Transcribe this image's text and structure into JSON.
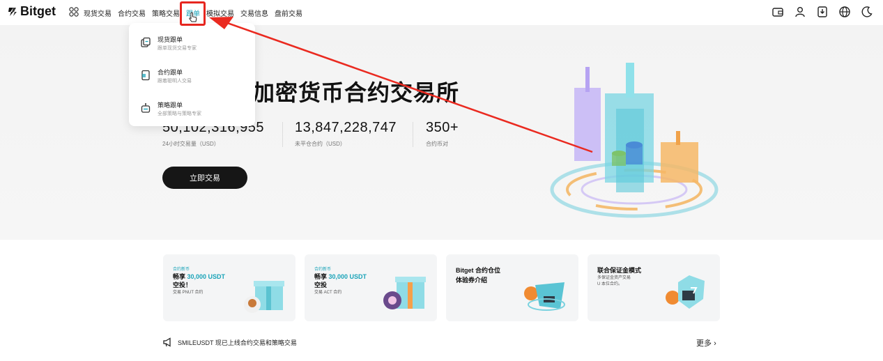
{
  "brand": {
    "name": "Bitget",
    "accent": "#19a3b8"
  },
  "nav": {
    "items": [
      "现货交易",
      "合约交易",
      "策略交易",
      "跟单",
      "模拟交易",
      "交易信息",
      "盘前交易"
    ],
    "active_index": 3
  },
  "top_icons": [
    "wallet-icon",
    "user-icon",
    "download-icon",
    "globe-icon",
    "moon-icon"
  ],
  "hero": {
    "title": "加密货币合约交易所",
    "stats": [
      {
        "value": "50,102,316,955",
        "label": "24小时交易量（USD）"
      },
      {
        "value": "13,847,228,747",
        "label": "未平仓合约（USD）"
      },
      {
        "value": "350+",
        "label": "合约币对"
      }
    ],
    "cta_label": "立即交易"
  },
  "dropdown": {
    "items": [
      {
        "title": "现货跟单",
        "subtitle": "跟单现货交易专家",
        "icon": "spot-copy-icon"
      },
      {
        "title": "合约跟单",
        "subtitle": "跟着聪明人交易",
        "icon": "futures-copy-icon"
      },
      {
        "title": "策略跟单",
        "subtitle": "全部策略与策略专家",
        "icon": "bot-copy-icon"
      }
    ]
  },
  "cards": [
    {
      "tag": "合约新币",
      "line1": "畅享 ",
      "accent": "30,000 USDT",
      "line2": "空投！",
      "sub": "交易 PNUT 合约"
    },
    {
      "tag": "合约新币",
      "line1": "畅享 ",
      "accent": "30,000 USDT",
      "line2": "空投",
      "sub": "交易 ACT 合约"
    },
    {
      "title": "Bitget 合约仓位\n体验券介绍"
    },
    {
      "title": "联合保证金模式",
      "sub": "多保证金资产交易\nU 本位合约。"
    }
  ],
  "announcement": {
    "text": "SMILEUSDT 现已上线合约交易和策略交易",
    "more_label": "更多"
  }
}
